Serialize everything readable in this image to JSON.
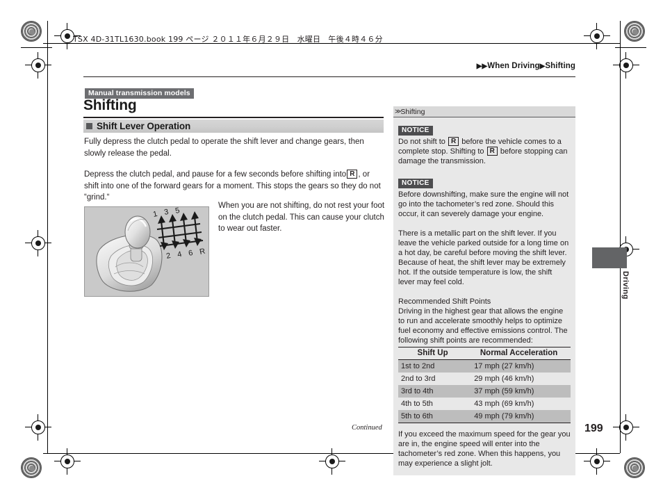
{
  "header": {
    "book_line": "TSX 4D-31TL1630.book   199 ページ   ２０１１年６月２９日　水曜日　午後４時４６分",
    "running_head_prefix": "▶▶",
    "running_head_1": "When Driving",
    "running_head_sep": "▶",
    "running_head_2": "Shifting"
  },
  "left": {
    "model_tag": "Manual transmission models",
    "chapter_title": "Shifting",
    "section_title": "Shift Lever Operation",
    "paragraph_1": "Fully depress the clutch pedal to operate the shift lever and change gears, then slowly release the pedal.",
    "paragraph_2_a": "Depress the clutch pedal, and pause for a few seconds before shifting into",
    "paragraph_2_gear": "R",
    "paragraph_2_b": ", or shift into one of the forward gears for a moment. This stops the gears so they do not “grind.“",
    "side_paragraph": "When you are not shifting, do not rest your foot on the clutch pedal. This can cause your clutch to wear out faster.",
    "figure_gear_labels": [
      "1",
      "3",
      "5",
      "2",
      "4",
      "6",
      "R"
    ],
    "continued": "Continued"
  },
  "sidebar": {
    "head_glyph": "≫",
    "head_title": "Shifting",
    "notice_label_1": "NOTICE",
    "notice_1_a": "Do not shift to",
    "notice_1_gear": "R",
    "notice_1_b": "before the vehicle comes to a complete stop.",
    "notice_1_c": "Shifting to",
    "notice_1_gear2": "R",
    "notice_1_d": "before stopping can damage the transmission.",
    "notice_label_2": "NOTICE",
    "notice_2": "Before downshifting, make sure the engine will not go into the tachometer’s red zone. Should this occur, it can severely damage your engine.",
    "paragraph_metallic": "There is a metallic part on the shift lever. If you leave the vehicle parked outside for a long time on a hot day, be careful before moving the shift lever. Because of heat, the shift lever may be extremely hot. If the outside temperature is low, the shift lever may feel cold.",
    "recommended_title": "Recommended Shift Points",
    "recommended_body": "Driving in the highest gear that allows the engine to run and accelerate smoothly helps to optimize fuel economy and effective emissions control. The following shift points are recommended:",
    "table": {
      "columns": [
        "Shift Up",
        "Normal Acceleration"
      ],
      "rows": [
        [
          "1st to 2nd",
          "17 mph (27 km/h)"
        ],
        [
          "2nd to 3rd",
          "29 mph (46 km/h)"
        ],
        [
          "3rd to 4th",
          "37 mph (59 km/h)"
        ],
        [
          "4th to 5th",
          "43 mph (69 km/h)"
        ],
        [
          "5th to 6th",
          "49 mph (79 km/h)"
        ]
      ]
    },
    "closing_paragraph": "If you exceed the maximum speed for the gear you are in, the engine speed will enter into the tachometer’s red zone. When this happens, you may experience a slight jolt."
  },
  "thumb": {
    "label": "Driving"
  },
  "footer": {
    "page_number": "199"
  },
  "colors": {
    "tag_gray": "#6d6e71",
    "section_band": "#cfcfcf",
    "sidebar_bg": "#e8e8e8",
    "table_alt": "#bdbdbd",
    "thumb_tab": "#636466"
  }
}
